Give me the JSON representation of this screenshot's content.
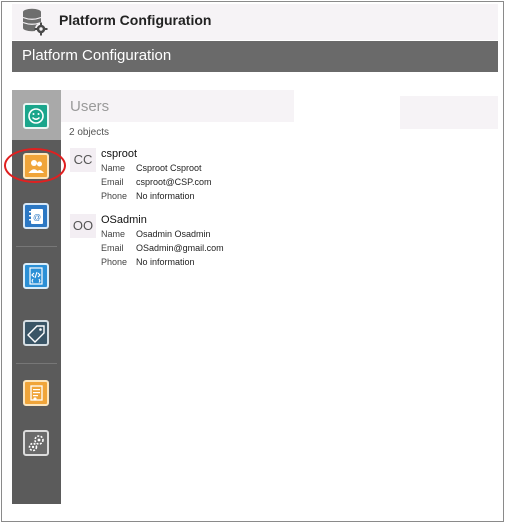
{
  "app": {
    "title": "Platform Configuration",
    "icon": "database-gear-icon"
  },
  "subheader": {
    "title": "Platform Configuration"
  },
  "sidebar": {
    "items": [
      {
        "name": "smiley-icon",
        "color": "#1aa68c",
        "active": true
      },
      {
        "name": "users-icon",
        "color": "#f0a53a",
        "highlighted": true
      },
      {
        "name": "address-book-icon",
        "color": "#2b78c4"
      },
      {
        "name": "code-icon",
        "color": "#2b90d6"
      },
      {
        "name": "tag-icon",
        "color": "#3a5566"
      },
      {
        "name": "report-icon",
        "color": "#f0a53a"
      },
      {
        "name": "settings-gears-icon",
        "color": "#6b6b6b"
      }
    ]
  },
  "users_panel": {
    "title": "Users",
    "count_text": "2 objects",
    "users": [
      {
        "initials": "CC",
        "username": "csproot",
        "fields": [
          {
            "label": "Name",
            "value": "Csproot Csproot"
          },
          {
            "label": "Email",
            "value": "csproot@CSP.com"
          },
          {
            "label": "Phone",
            "value": "No information"
          }
        ]
      },
      {
        "initials": "OO",
        "username": "OSadmin",
        "fields": [
          {
            "label": "Name",
            "value": "Osadmin Osadmin"
          },
          {
            "label": "Email",
            "value": "OSadmin@gmail.com"
          },
          {
            "label": "Phone",
            "value": "No information"
          }
        ]
      }
    ]
  }
}
